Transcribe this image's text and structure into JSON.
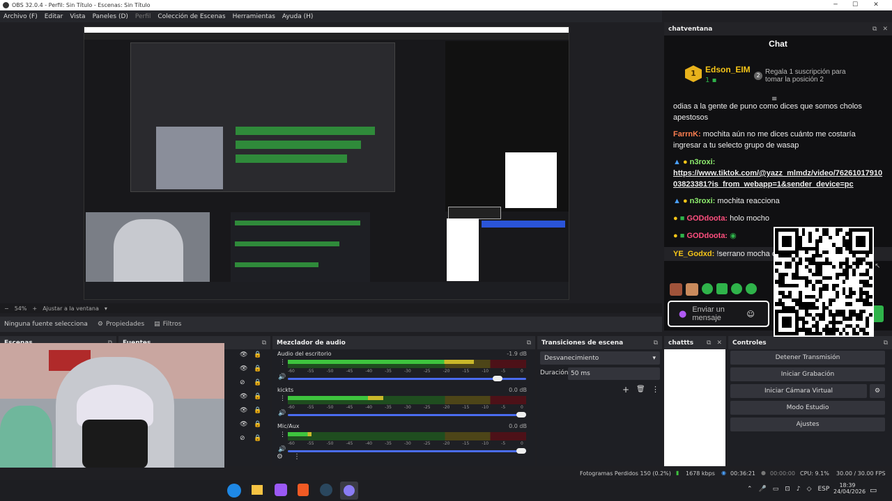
{
  "window": {
    "title": "OBS 32.0.4 - Perfil: Sin Título - Escenas: Sin Título"
  },
  "menu": [
    "Archivo (F)",
    "Editar",
    "Vista",
    "Paneles (D)",
    "Perfil",
    "Colección de Escenas",
    "Herramientas",
    "Ayuda (H)"
  ],
  "zoom": {
    "percent": "54%",
    "fit_label": "Ajustar a la ventana"
  },
  "source_bar": {
    "no_source": "Ninguna fuente selecciona",
    "properties": "Propiedades",
    "filters": "Filtros"
  },
  "docks": {
    "scenes": "Escenas",
    "sources": "Fuentes",
    "mixer": "Mezclador de audio",
    "transitions": "Transiciones de escena",
    "chatts": "chattts",
    "controls": "Controles",
    "chat": "chatventana"
  },
  "chat": {
    "title": "Chat",
    "leader": {
      "rank": "1",
      "name": "Edson_EIM",
      "count": "1"
    },
    "second": {
      "rank": "2",
      "text": "Regala 1 suscripción para tomar la posición 2"
    },
    "messages": [
      {
        "user": "",
        "text": "odias a la gente de puno como dices que somos cholos apestosos",
        "color": "#eeeeee"
      },
      {
        "user": "FarrnK:",
        "text": "mochita aún no me dices cuánto me costaría ingresar a tu selecto grupo de wasap",
        "color": "#ff7f50"
      },
      {
        "user": "n3roxi:",
        "text": "https://www.tiktok.com/@yazz_mlmdz/video/7626101791003823381?is_from_webapp=1&sender_device=pc",
        "color": "#8fef6f"
      },
      {
        "user": "n3roxi:",
        "text": "mochita reacciona",
        "color": "#8fef6f"
      },
      {
        "user": "GODdoota:",
        "text": "holo mocho",
        "color": "#ff4f7f"
      },
      {
        "user": "GODdoota:",
        "text": "",
        "color": "#ff4f7f"
      },
      {
        "user": "YE_Godxd:",
        "text": "!serrano mocha confirma pelada",
        "color": "#f5c518"
      }
    ],
    "send_label": "Enviar un mensaje"
  },
  "mixer": {
    "channels": [
      {
        "name": "Audio del escritorio",
        "db": "-1.9 dB",
        "level": 0.78
      },
      {
        "name": "kickts",
        "db": "0.0 dB",
        "level": 0.4
      },
      {
        "name": "Mic/Aux",
        "db": "0.0 dB",
        "level": 0.1
      }
    ],
    "scale": [
      "-60",
      "-55",
      "-50",
      "-45",
      "-40",
      "-35",
      "-30",
      "-25",
      "-20",
      "-15",
      "-10",
      "-5",
      "0"
    ]
  },
  "transitions": {
    "selected": "Desvanecimiento",
    "duration_label": "Duración",
    "duration_value": "50 ms"
  },
  "controls": {
    "buttons": [
      "Detener Transmisión",
      "Iniciar Grabación",
      "Iniciar Cámara Virtual",
      "Modo Estudio",
      "Ajustes"
    ]
  },
  "status": {
    "frames": "Fotogramas Perdidos 150 (0.2%)",
    "kbps": "1678 kbps",
    "live": "00:36:21",
    "rec": "00:00:00",
    "cpu": "CPU: 9.1%",
    "fps": "30.00 / 30.00 FPS"
  },
  "tray": {
    "lang": "ESP",
    "time": "18:39",
    "date": "24/04/2026"
  },
  "colors": {
    "accent": "#2a54d8",
    "green": "#3ec43e",
    "yellow": "#c9b82a",
    "red": "#b0202e",
    "chat_green": "#2fb34a"
  }
}
